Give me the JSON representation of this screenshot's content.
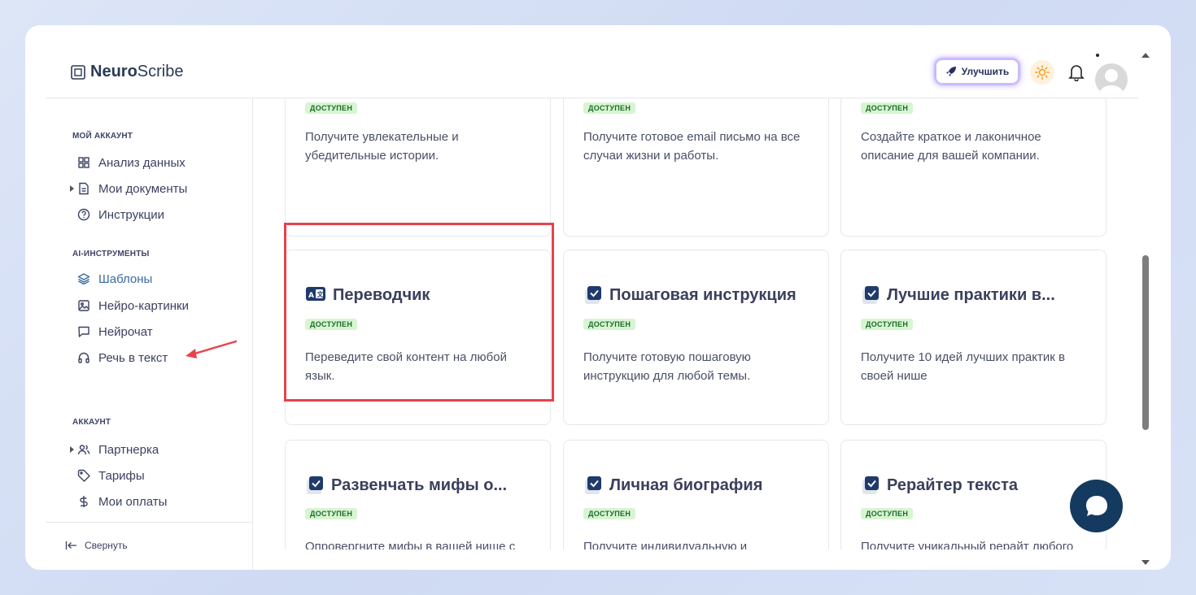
{
  "app": {
    "logo_bold": "Neuro",
    "logo_rest": "Scribe"
  },
  "header": {
    "upgrade_label": "Улучшить"
  },
  "sidebar": {
    "sections": [
      {
        "title": "МОЙ АККАУНТ",
        "items": [
          "Анализ данных",
          "Мои документы",
          "Инструкции"
        ]
      },
      {
        "title": "AI-ИНСТРУМЕНТЫ",
        "items": [
          "Шаблоны",
          "Нейро-картинки",
          "Нейрочат",
          "Речь в текст"
        ]
      },
      {
        "title": "АККАУНТ",
        "items": [
          "Партнерка",
          "Тарифы",
          "Мои оплаты"
        ]
      }
    ],
    "active_item": "Шаблоны",
    "collapse_label": "Свернуть"
  },
  "badge_label": "ДОСТУПЕН",
  "cards": [
    {
      "title": "",
      "desc": "Получите увлекательные и убедительные истории."
    },
    {
      "title": "",
      "desc": "Получите готовое email письмо на все случаи жизни и работы."
    },
    {
      "title": "",
      "desc": "Создайте краткое и лаконичное описание для вашей компании."
    },
    {
      "title": "Переводчик",
      "desc": "Переведите свой контент на любой язык.",
      "icon": "translate-icon"
    },
    {
      "title": "Пошаговая инструкция",
      "desc": "Получите готовую пошаговую инструкцию для любой темы.",
      "icon": "checkbox-icon"
    },
    {
      "title": "Лучшие практики в...",
      "desc": "Получите 10 идей лучших практик в своей нише",
      "icon": "checkbox-icon"
    },
    {
      "title": "Развенчать мифы о...",
      "desc": "Опровергните мифы в вашей нише с помощью научных данных",
      "icon": "checkbox-icon"
    },
    {
      "title": "Личная биография",
      "desc": "Получите индивидуальную и привлекательную биографию",
      "icon": "checkbox-icon"
    },
    {
      "title": "Рерайтер текста",
      "desc": "Получите уникальный рерайт любого текста",
      "icon": "checkbox-icon"
    }
  ],
  "colors": {
    "accent": "#3a6aa4",
    "highlight": "#e8424b",
    "badge_bg": "#d7f5d2",
    "chat": "#143a5f"
  }
}
